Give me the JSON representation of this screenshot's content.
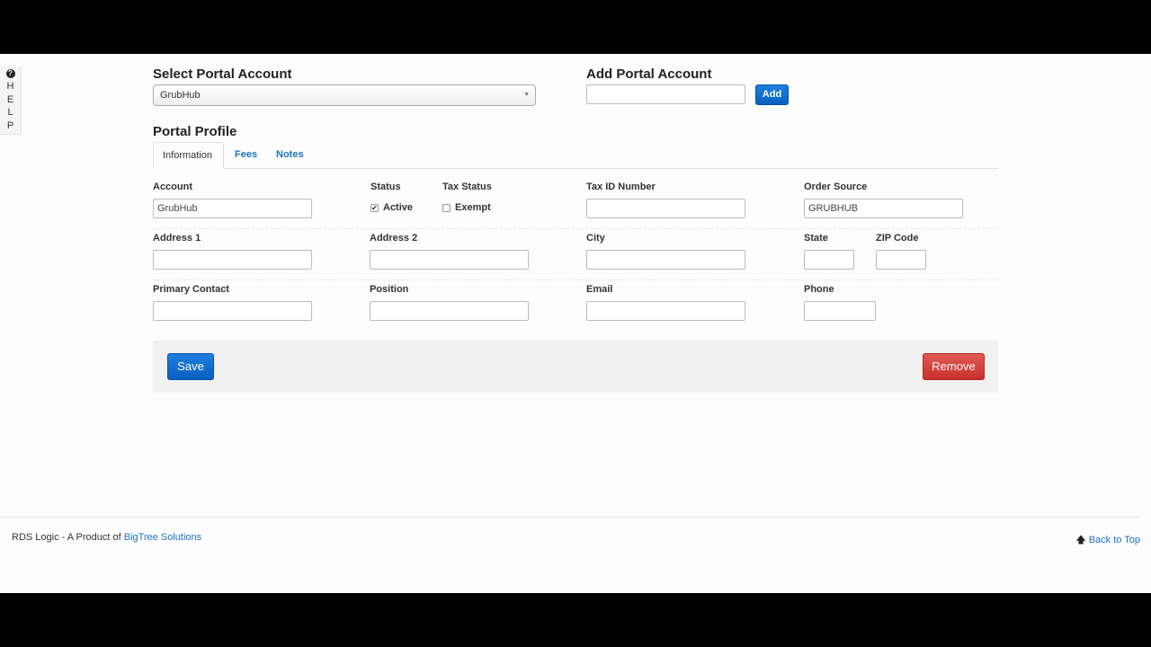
{
  "help": {
    "icon": "question-circle-icon",
    "letters": [
      "H",
      "E",
      "L",
      "P"
    ]
  },
  "select_portal": {
    "title": "Select Portal Account",
    "selected": "GrubHub"
  },
  "add_portal": {
    "title": "Add Portal Account",
    "input_value": "",
    "button_label": "Add"
  },
  "profile": {
    "title": "Portal Profile",
    "tabs": [
      {
        "label": "Information",
        "active": true
      },
      {
        "label": "Fees",
        "active": false
      },
      {
        "label": "Notes",
        "active": false
      }
    ]
  },
  "form": {
    "account": {
      "label": "Account",
      "value": "GrubHub"
    },
    "status": {
      "label": "Status",
      "checkbox_label": "Active",
      "checked": true
    },
    "tax_status": {
      "label": "Tax Status",
      "checkbox_label": "Exempt",
      "checked": false
    },
    "tax_id": {
      "label": "Tax ID Number",
      "value": ""
    },
    "order_source": {
      "label": "Order Source",
      "value": "GRUBHUB"
    },
    "address1": {
      "label": "Address 1",
      "value": ""
    },
    "address2": {
      "label": "Address 2",
      "value": ""
    },
    "city": {
      "label": "City",
      "value": ""
    },
    "state": {
      "label": "State",
      "value": ""
    },
    "zip": {
      "label": "ZIP Code",
      "value": ""
    },
    "primary_contact": {
      "label": "Primary Contact",
      "value": ""
    },
    "position": {
      "label": "Position",
      "value": ""
    },
    "email": {
      "label": "Email",
      "value": ""
    },
    "phone": {
      "label": "Phone",
      "value": ""
    }
  },
  "actions": {
    "save_label": "Save",
    "remove_label": "Remove"
  },
  "footer": {
    "text": "RDS Logic - A Product of ",
    "link_text": "BigTree Solutions",
    "back_to_top": "Back to Top"
  },
  "colors": {
    "accent": "#1a72c4",
    "primary_button": "#0a5fc0",
    "danger_button": "#c9302c"
  }
}
